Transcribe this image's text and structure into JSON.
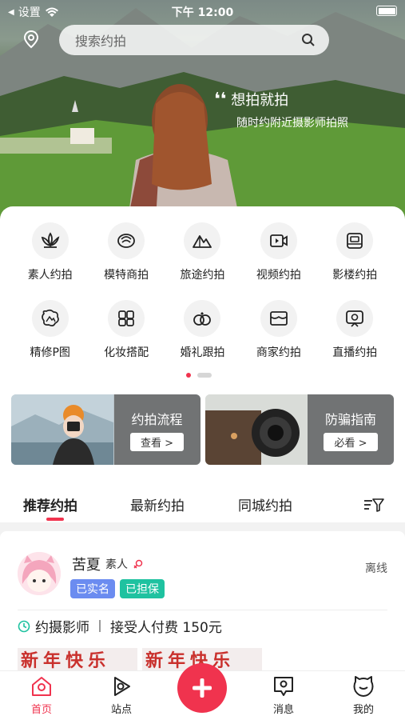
{
  "status_bar": {
    "back_app": "设置",
    "time": "下午 12:00"
  },
  "search": {
    "placeholder": "搜索约拍"
  },
  "hero": {
    "title": "想拍就拍",
    "subtitle": "随时约附近摄影师拍照"
  },
  "categories": [
    {
      "label": "素人约拍",
      "icon": "lotus-icon"
    },
    {
      "label": "模特商拍",
      "icon": "flower-icon"
    },
    {
      "label": "旅途约拍",
      "icon": "mountain-icon"
    },
    {
      "label": "视频约拍",
      "icon": "video-icon"
    },
    {
      "label": "影楼约拍",
      "icon": "camera-icon"
    },
    {
      "label": "精修P图",
      "icon": "photo-edit-icon"
    },
    {
      "label": "化妆搭配",
      "icon": "makeup-icon"
    },
    {
      "label": "婚礼跟拍",
      "icon": "rings-icon"
    },
    {
      "label": "商家约拍",
      "icon": "shop-icon"
    },
    {
      "label": "直播约拍",
      "icon": "live-icon"
    }
  ],
  "banners": [
    {
      "title": "约拍流程",
      "button": "查看 >"
    },
    {
      "title": "防骗指南",
      "button": "必看 >"
    }
  ],
  "tabs": [
    {
      "label": "推荐约拍",
      "active": true
    },
    {
      "label": "最新约拍",
      "active": false
    },
    {
      "label": "同城约拍",
      "active": false
    }
  ],
  "post": {
    "name": "苦夏",
    "role": "素人",
    "status": "离线",
    "tags": [
      {
        "label": "已实名",
        "color": "#6b8cf0"
      },
      {
        "label": "已担保",
        "color": "#1fc2a0"
      }
    ],
    "need": "约摄影师",
    "fee": "接受人付费 150元",
    "thumb_text": "新年快乐"
  },
  "nav": [
    {
      "label": "首页",
      "active": true
    },
    {
      "label": "站点",
      "active": false
    },
    {
      "label": "消息",
      "active": false
    },
    {
      "label": "我的",
      "active": false
    }
  ],
  "colors": {
    "accent": "#f0334e"
  }
}
